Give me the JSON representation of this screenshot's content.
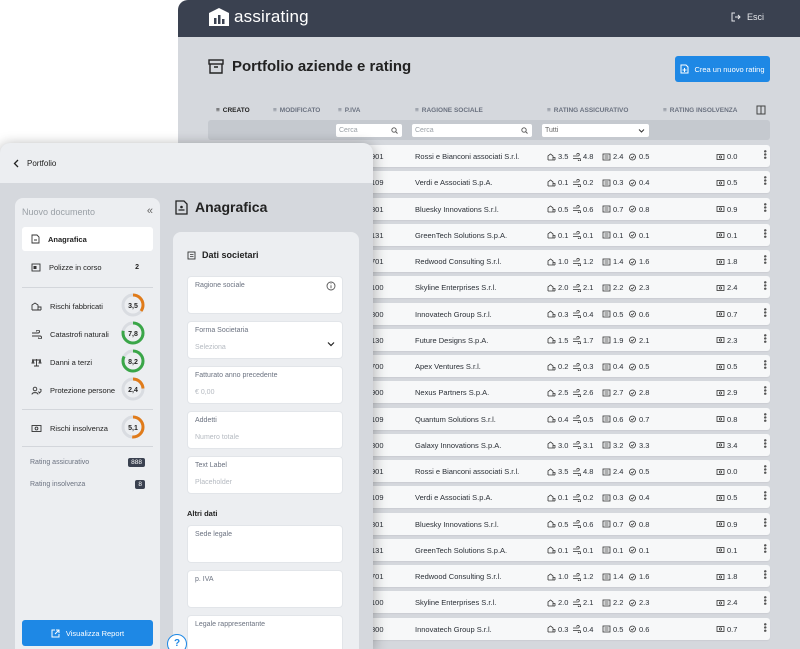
{
  "app": {
    "brand": "assirating",
    "logout_label": "Esci"
  },
  "page": {
    "title": "Portfolio aziende e rating",
    "new_rating_button": "Crea un nuovo rating"
  },
  "columns": {
    "created": "CREATO",
    "modified": "MODIFICATO",
    "piva": "P.IVA",
    "company_name": "RAGIONE SOCIALE",
    "insurance_rating": "RATING ASSICURATIVO",
    "insolvency_rating": "RATING INSOLVENZA"
  },
  "filters": {
    "piva_placeholder": "Cerca",
    "name_placeholder": "Cerca",
    "rating_select_value": "Tutti"
  },
  "rows": [
    {
      "piva": "901",
      "name": "Rossi e Bianconi associati S.r.l.",
      "r1": "3.5",
      "r2": "4.8",
      "r3": "2.4",
      "r4": "0.5",
      "ins": "0.0"
    },
    {
      "piva": "109",
      "name": "Verdi e Associati S.p.A.",
      "r1": "0.1",
      "r2": "0.2",
      "r3": "0.3",
      "r4": "0.4",
      "ins": "0.5"
    },
    {
      "piva": "801",
      "name": "Bluesky Innovations S.r.l.",
      "r1": "0.5",
      "r2": "0.6",
      "r3": "0.7",
      "r4": "0.8",
      "ins": "0.9"
    },
    {
      "piva": "131",
      "name": "GreenTech Solutions S.p.A.",
      "r1": "0.1",
      "r2": "0.1",
      "r3": "0.1",
      "r4": "0.1",
      "ins": "0.1"
    },
    {
      "piva": "701",
      "name": "Redwood Consulting S.r.l.",
      "r1": "1.0",
      "r2": "1.2",
      "r3": "1.4",
      "r4": "1.6",
      "ins": "1.8"
    },
    {
      "piva": "100",
      "name": "Skyline Enterprises S.r.l.",
      "r1": "2.0",
      "r2": "2.1",
      "r3": "2.2",
      "r4": "2.3",
      "ins": "2.4"
    },
    {
      "piva": "800",
      "name": "Innovatech Group S.r.l.",
      "r1": "0.3",
      "r2": "0.4",
      "r3": "0.5",
      "r4": "0.6",
      "ins": "0.7"
    },
    {
      "piva": "130",
      "name": "Future Designs S.p.A.",
      "r1": "1.5",
      "r2": "1.7",
      "r3": "1.9",
      "r4": "2.1",
      "ins": "2.3"
    },
    {
      "piva": "700",
      "name": "Apex Ventures S.r.l.",
      "r1": "0.2",
      "r2": "0.3",
      "r3": "0.4",
      "r4": "0.5",
      "ins": "0.5"
    },
    {
      "piva": "900",
      "name": "Nexus Partners S.p.A.",
      "r1": "2.5",
      "r2": "2.6",
      "r3": "2.7",
      "r4": "2.8",
      "ins": "2.9"
    },
    {
      "piva": "109",
      "name": "Quantum Solutions S.r.l.",
      "r1": "0.4",
      "r2": "0.5",
      "r3": "0.6",
      "r4": "0.7",
      "ins": "0.8"
    },
    {
      "piva": "800",
      "name": "Galaxy Innovations S.p.A.",
      "r1": "3.0",
      "r2": "3.1",
      "r3": "3.2",
      "r4": "3.3",
      "ins": "3.4"
    },
    {
      "piva": "901",
      "name": "Rossi e Bianconi associati S.r.l.",
      "r1": "3.5",
      "r2": "4.8",
      "r3": "2.4",
      "r4": "0.5",
      "ins": "0.0"
    },
    {
      "piva": "109",
      "name": "Verdi e Associati S.p.A.",
      "r1": "0.1",
      "r2": "0.2",
      "r3": "0.3",
      "r4": "0.4",
      "ins": "0.5"
    },
    {
      "piva": "801",
      "name": "Bluesky Innovations S.r.l.",
      "r1": "0.5",
      "r2": "0.6",
      "r3": "0.7",
      "r4": "0.8",
      "ins": "0.9"
    },
    {
      "piva": "131",
      "name": "GreenTech Solutions S.p.A.",
      "r1": "0.1",
      "r2": "0.1",
      "r3": "0.1",
      "r4": "0.1",
      "ins": "0.1"
    },
    {
      "piva": "701",
      "name": "Redwood Consulting S.r.l.",
      "r1": "1.0",
      "r2": "1.2",
      "r3": "1.4",
      "r4": "1.6",
      "ins": "1.8"
    },
    {
      "piva": "100",
      "name": "Skyline Enterprises S.r.l.",
      "r1": "2.0",
      "r2": "2.1",
      "r3": "2.2",
      "r4": "2.3",
      "ins": "2.4"
    },
    {
      "piva": "800",
      "name": "Innovatech Group S.r.l.",
      "r1": "0.3",
      "r2": "0.4",
      "r3": "0.5",
      "r4": "0.6",
      "ins": "0.7"
    }
  ],
  "panel": {
    "back_label": "Portfolio",
    "sidebar_title": "Nuovo documento",
    "items": {
      "anagrafica": "Anagrafica",
      "polizze": "Polizze in corso",
      "polizze_count": "2",
      "fabbricati": "Rischi fabbricati",
      "fabbricati_score": "3,5",
      "catastrofi": "Catastrofi naturali",
      "catastrofi_score": "7,8",
      "danni": "Danni a terzi",
      "danni_score": "8,2",
      "protezione": "Protezione persone",
      "protezione_score": "2,4",
      "insolvenza": "Rischi insolvenza",
      "insolvenza_score": "5,1"
    },
    "rating_assicurativo_label": "Rating assicurativo",
    "rating_assicurativo_value": "888",
    "rating_insolvenza_label": "Rating insolvenza",
    "rating_insolvenza_value": "8",
    "view_report_button": "Visualizza Report",
    "section_title": "Anagrafica",
    "form_section": "Dati societari",
    "fields": {
      "ragione_label": "Ragione sociale",
      "forma_label": "Forma Societaria",
      "forma_placeholder": "Seleziona",
      "fatturato_label": "Fatturato anno precedente",
      "fatturato_placeholder": "€ 0,00",
      "addetti_label": "Addetti",
      "addetti_placeholder": "Numero totale",
      "text_label": "Text Label",
      "text_placeholder": "Placeholder",
      "altri_title": "Altri dati",
      "sede_label": "Sede legale",
      "piva_label": "p. IVA",
      "legale_label": "Legale rappresentante"
    },
    "help_label": "?"
  },
  "colors": {
    "topbar": "#3a4150",
    "accent": "#1e88e5",
    "background": "#d5d8dd",
    "gauge_orange": "#e07b1a",
    "gauge_green": "#3aa648"
  }
}
